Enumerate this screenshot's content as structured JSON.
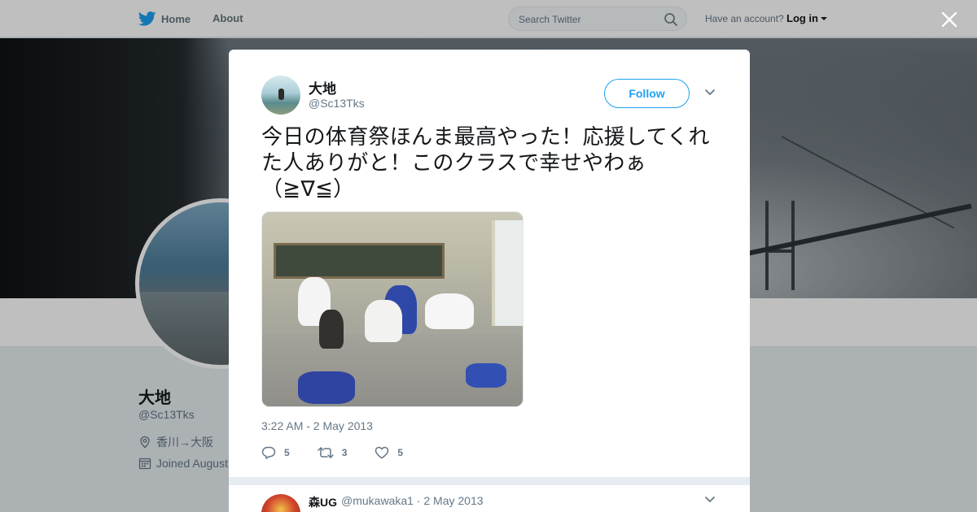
{
  "topbar": {
    "home_label": "Home",
    "about_label": "About",
    "search_placeholder": "Search Twitter",
    "account_prompt": "Have an account?",
    "login_label": "Log in"
  },
  "profile": {
    "name": "大地",
    "handle": "@Sc13Tks",
    "location": "香川→大阪",
    "joined": "Joined August"
  },
  "tweet": {
    "author_name": "大地",
    "author_handle": "@Sc13Tks",
    "follow_label": "Follow",
    "text": "今日の体育祭ほんま最高やった！応援してくれた人ありがと！このクラスで幸せやわぁ（≧∇≦）",
    "timestamp": "3:22 AM - 2 May 2013",
    "replies": "5",
    "retweets": "3",
    "likes": "5"
  },
  "reply": {
    "name": "森UG",
    "meta": "@mukawaka1 · 2 May 2013"
  },
  "colors": {
    "accent": "#1da1f2",
    "muted": "#657786",
    "text": "#14171a",
    "background": "#e6ecf0"
  },
  "icons": {
    "logo": "twitter-bird-icon",
    "search": "search-icon",
    "close": "close-icon",
    "caret": "chevron-down-icon",
    "reply": "reply-icon",
    "retweet": "retweet-icon",
    "like": "heart-icon",
    "location": "location-pin-icon",
    "calendar": "calendar-icon"
  }
}
